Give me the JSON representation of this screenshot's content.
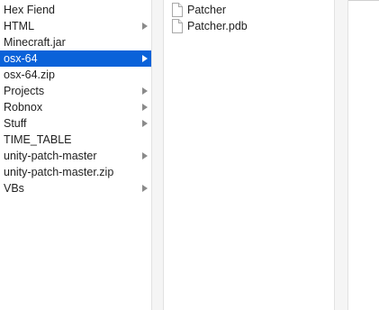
{
  "column1": {
    "items": [
      {
        "label": "Hex Fiend",
        "folder": false,
        "selected": false
      },
      {
        "label": "HTML",
        "folder": true,
        "selected": false
      },
      {
        "label": "Minecraft.jar",
        "folder": false,
        "selected": false
      },
      {
        "label": "osx-64",
        "folder": true,
        "selected": true
      },
      {
        "label": "osx-64.zip",
        "folder": false,
        "selected": false
      },
      {
        "label": "Projects",
        "folder": true,
        "selected": false
      },
      {
        "label": "Robnox",
        "folder": true,
        "selected": false
      },
      {
        "label": "Stuff",
        "folder": true,
        "selected": false
      },
      {
        "label": "TIME_TABLE",
        "folder": false,
        "selected": false
      },
      {
        "label": "unity-patch-master",
        "folder": true,
        "selected": false
      },
      {
        "label": "unity-patch-master.zip",
        "folder": false,
        "selected": false
      },
      {
        "label": "VBs",
        "folder": true,
        "selected": false
      }
    ]
  },
  "column2": {
    "items": [
      {
        "label": "Patcher",
        "icon": "document-icon"
      },
      {
        "label": "Patcher.pdb",
        "icon": "document-icon"
      }
    ]
  },
  "colors": {
    "selection": "#0a62d9",
    "chevron": "#8a8a8a",
    "chevron_selected": "#ffffff"
  }
}
